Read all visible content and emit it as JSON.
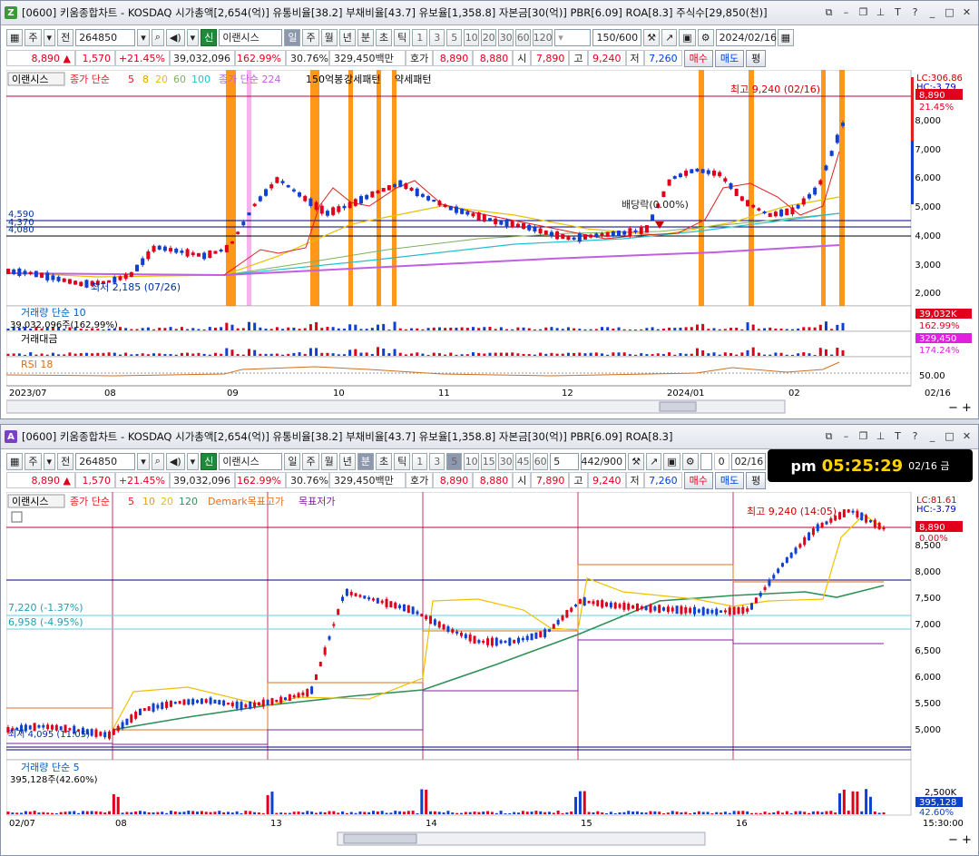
{
  "top": {
    "title": "[0600] 키움종합차트 - KOSDAQ 시가총액[2,654(억)] 유통비율[38.2] 부채비율[43.7] 유보율[1,358.8] 자본금[30(억)] PBR[6.09] ROA[8.3] 주식수[29,850(천)]",
    "badge": "Z",
    "toolbar": {
      "type1": "주",
      "type2": "전",
      "code": "264850",
      "name_label": "이랜시스",
      "badge": "신",
      "periods": [
        "일",
        "주",
        "월",
        "년",
        "분",
        "초",
        "틱"
      ],
      "numbers": [
        "1",
        "3",
        "5",
        "10",
        "20",
        "30",
        "60",
        "120"
      ],
      "count": "150/600",
      "date": "2024/02/16"
    },
    "quote": {
      "price": "8,890 ▲",
      "change": "1,570",
      "rate": "+21.45%",
      "volume": "39,032,096",
      "vol_ratio": "162.99%",
      "turnover": "30.76%",
      "amount": "329,450백만",
      "hoga_label": "호가",
      "hoga": "8,890",
      "hoga2": "8,880",
      "open_label": "시",
      "open": "7,890",
      "high_label": "고",
      "high": "9,240",
      "low_label": "저",
      "low": "7,260",
      "buy": "매수",
      "sell": "매도",
      "flat": "평"
    },
    "legend": {
      "name": "이랜시스",
      "ma_label": "종가 단순",
      "ma": [
        "5",
        "8",
        "20",
        "60",
        "100"
      ],
      "ma2": "종가 단순 224",
      "pattern1": "150억봉",
      "pattern2": "강세패턴",
      "pattern3": "약세패턴"
    },
    "price_labels": [
      "8,000",
      "7,000",
      "6,000",
      "5,000",
      "4,000",
      "3,000",
      "2,000"
    ],
    "right_tags": {
      "lc": "LC:306.86",
      "hc": "HC:-3.79",
      "cur": "8,890",
      "pct": "21.45%",
      "vol": "39,032K",
      "vol_pct": "162.99%",
      "amt": "329,450",
      "amt_pct": "174.24%",
      "rsi": "50.00"
    },
    "annotations": {
      "high": "최고 9,240 (02/16)",
      "low": "최저 2,185 (07/26)",
      "div": "배당락(0.00%)",
      "lvl1": "4,590",
      "lvl2": "4,370",
      "lvl3": "4,080"
    },
    "sub": {
      "vol_title": "거래량 단순 10",
      "vol_value": "39,032,096주(162.99%)",
      "amt_title": "거래대금",
      "rsi_title": "RSI 18"
    },
    "xaxis": [
      "2023/07",
      "08",
      "09",
      "10",
      "11",
      "12",
      "2024/01",
      "02",
      "02/16"
    ]
  },
  "bottom": {
    "title": "[0600] 키움종합차트 - KOSDAQ 시가총액[2,654(억)] 유통비율[38.2] 부채비율[43.7] 유보율[1,358.8] 자본금[30(억)] PBR[6.09] ROA[8.3]",
    "badge": "A",
    "toolbar": {
      "type1": "주",
      "type2": "전",
      "code": "264850",
      "name_label": "이랜시스",
      "badge": "신",
      "periods": [
        "일",
        "주",
        "월",
        "년",
        "분",
        "초",
        "틱"
      ],
      "numbers": [
        "1",
        "3",
        "5",
        "10",
        "15",
        "30",
        "45",
        "60"
      ],
      "minute": "5",
      "count": "442/900",
      "chk": "0",
      "date": "02/16"
    },
    "clock": {
      "ampm": "pm",
      "time": "05:25:29",
      "date": "02/16 금"
    },
    "quote": {
      "price": "8,890 ▲",
      "change": "1,570",
      "rate": "+21.45%",
      "volume": "39,032,096",
      "vol_ratio": "162.99%",
      "turnover": "30.76%",
      "amount": "329,450백만",
      "hoga_label": "호가",
      "hoga": "8,890",
      "hoga2": "8,880",
      "open_label": "시",
      "open": "7,890",
      "high_label": "고",
      "high": "9,240",
      "low_label": "저",
      "low": "7,260",
      "buy": "매수",
      "sell": "매도",
      "flat": "평"
    },
    "legend": {
      "name": "이랜시스",
      "ma_label": "종가 단순",
      "ma": [
        "5",
        "10",
        "20",
        "120"
      ],
      "demark": "Demark목표고가",
      "demark2": "목표저가"
    },
    "price_labels": [
      "8,500",
      "8,000",
      "7,500",
      "7,000",
      "6,500",
      "6,000",
      "5,500",
      "5,000"
    ],
    "right_tags": {
      "lc": "LC:81.61",
      "hc": "HC:-3.79",
      "cur": "8,890",
      "pct": "0.00%",
      "vol": "395,128",
      "vol_pct": "42.60%",
      "vlab": "2,500K"
    },
    "annotations": {
      "high": "최고 9,240 (14:05)",
      "l1": "7,220 (-1.37%)",
      "l2": "6,958 (-4.95%)",
      "low": "최저 4,095 (11:05)"
    },
    "sub": {
      "vol_title": "거래량 단순 5",
      "vol_value": "395,128주(42.60%)"
    },
    "xaxis": [
      "02/07",
      "08",
      "13",
      "14",
      "15",
      "16",
      "15:30:00"
    ]
  },
  "colors": {
    "up": "#e0001c",
    "down": "#1040d0",
    "orange": "#ff8c00",
    "pink": "#f5a0e8"
  }
}
